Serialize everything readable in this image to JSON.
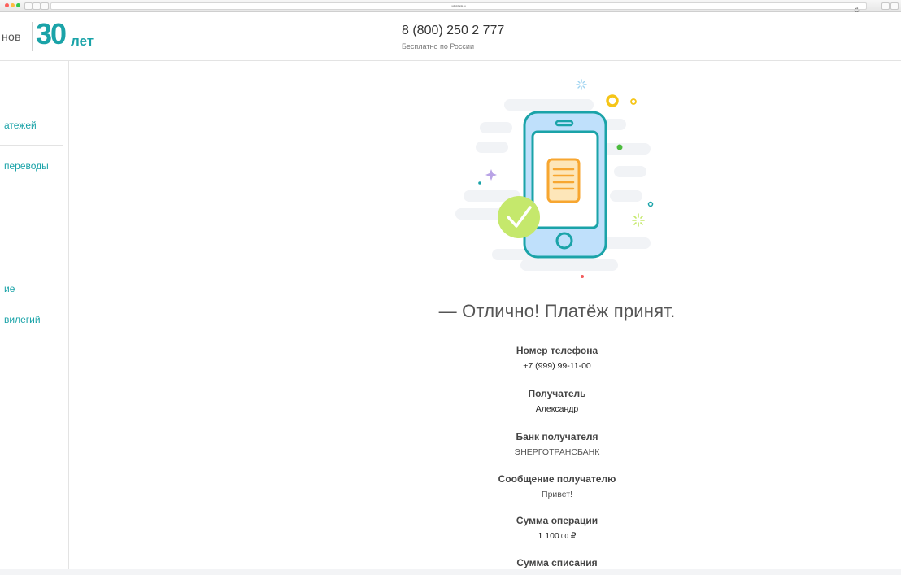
{
  "browser": {
    "url": "sdsd-bank.ru"
  },
  "header": {
    "brand_partial": "нов",
    "logo_number": "30",
    "logo_suffix": "лет",
    "phone": "8 (800) 250 2 777",
    "phone_note": "Бесплатно по России"
  },
  "sidebar": {
    "items": [
      {
        "label": "атежей"
      },
      {
        "label": "переводы"
      },
      {
        "label": "ие"
      },
      {
        "label": "вилегий"
      }
    ]
  },
  "result": {
    "headline": "— Отлично! Платёж принят."
  },
  "details": [
    {
      "label": "Номер телефона",
      "value": "+7 (999) 99-11-00"
    },
    {
      "label": "Получатель",
      "value": "Александр"
    },
    {
      "label": "Банк получателя",
      "value": "ЭНЕРГОТРАНСБАНК"
    },
    {
      "label": "Сообщение получателю",
      "value": "Привет!"
    },
    {
      "label": "Сумма операции",
      "value_int": "1 100",
      "value_dec": ".00",
      "value_cur": " ₽"
    },
    {
      "label": "Сумма списания"
    }
  ],
  "colors": {
    "accent": "#1aa3a8",
    "success": "#c5e86c",
    "phone_fill": "#bfe0fb",
    "document": "#f7a630"
  }
}
